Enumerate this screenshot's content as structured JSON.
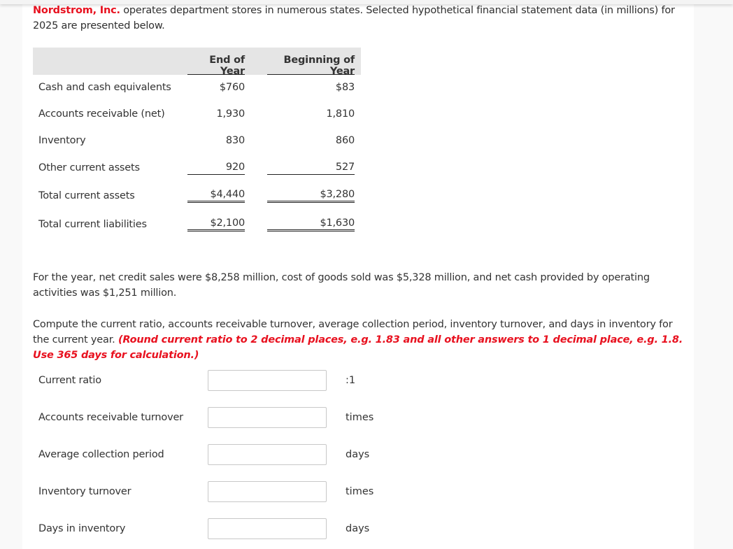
{
  "intro": {
    "company": "Nordstrom, Inc.",
    "text": " operates department stores in numerous states. Selected hypothetical financial statement data (in millions) for 2025 are presented below."
  },
  "table": {
    "headers": [
      "End of Year",
      "Beginning of Year"
    ],
    "rows": [
      {
        "label": "Cash and cash equivalents",
        "end": "$760",
        "beg": "$83"
      },
      {
        "label": "Accounts receivable (net)",
        "end": "1,930",
        "beg": "1,810"
      },
      {
        "label": "Inventory",
        "end": "830",
        "beg": "860"
      },
      {
        "label": "Other current assets",
        "end": "920",
        "beg": "527"
      },
      {
        "label": "Total current assets",
        "end": "$4,440",
        "beg": "$3,280"
      },
      {
        "label": "Total current liabilities",
        "end": "$2,100",
        "beg": "$1,630"
      }
    ]
  },
  "paragraph1": "For the year, net credit sales were $8,258 million, cost of goods sold was $5,328 million, and net cash provided by operating activities was $1,251 million.",
  "paragraph2": {
    "text": "Compute the current ratio, accounts receivable turnover, average collection period, inventory turnover, and days in inventory for the current year. ",
    "instruction": "(Round current ratio to 2 decimal places, e.g. 1.83 and all other answers to 1 decimal place, e.g. 1.8. Use 365 days for calculation.)"
  },
  "questions": [
    {
      "label": "Current ratio",
      "value": "",
      "unit": ":1"
    },
    {
      "label": "Accounts receivable turnover",
      "value": "",
      "unit": "times"
    },
    {
      "label": "Average collection period",
      "value": "",
      "unit": "days"
    },
    {
      "label": "Inventory turnover",
      "value": "",
      "unit": "times"
    },
    {
      "label": "Days in inventory",
      "value": "",
      "unit": "days"
    }
  ],
  "colors": {
    "accent_red": "#e8111f",
    "table_header_bg": "#e5e5e5",
    "page_bg": "#f9f9f9"
  }
}
